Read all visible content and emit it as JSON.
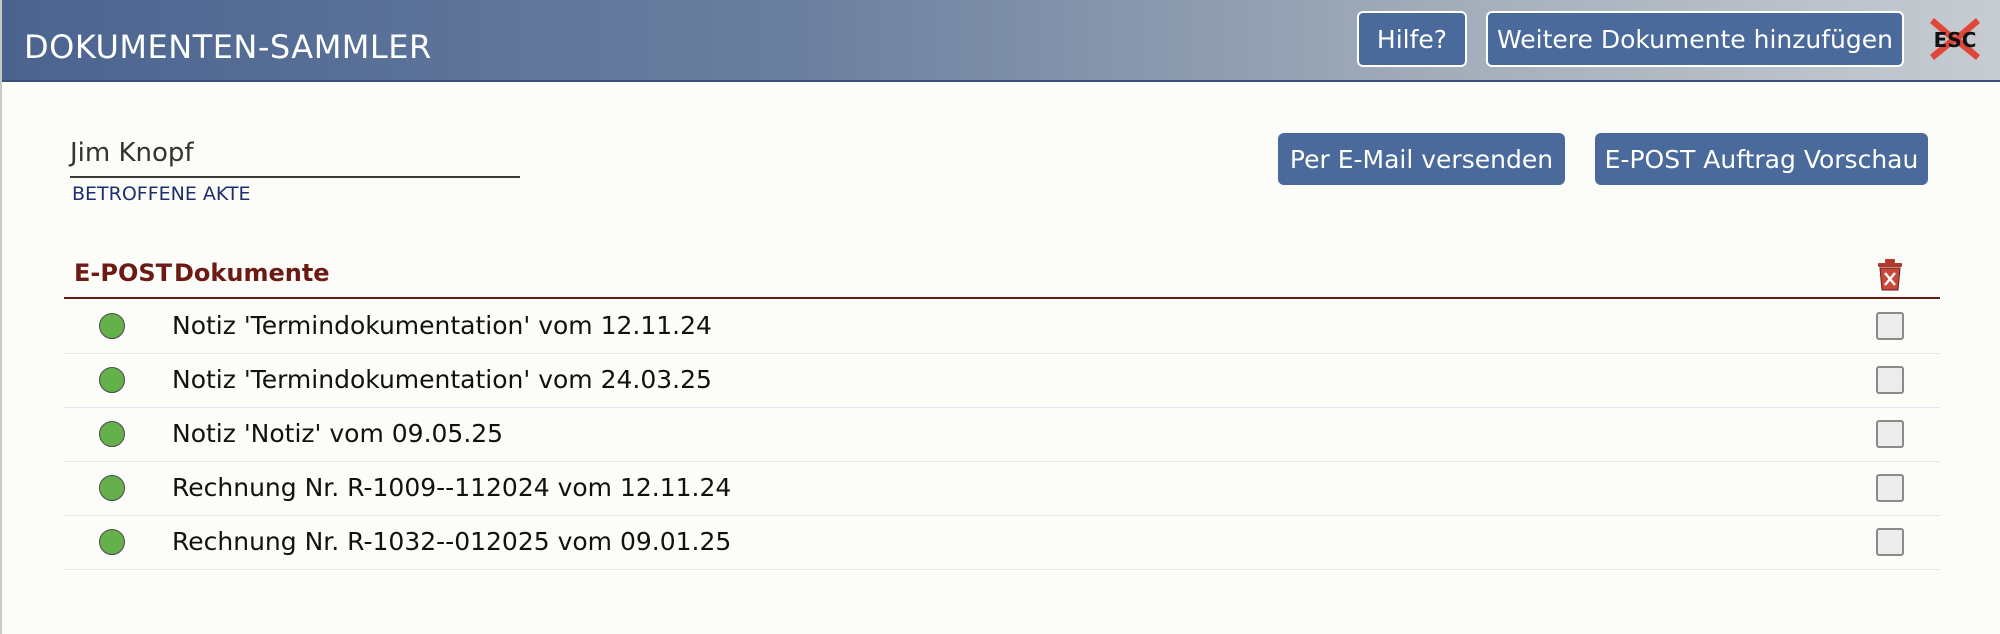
{
  "header": {
    "title": "DOKUMENTEN-SAMMLER",
    "help_label": "Hilfe?",
    "add_label": "Weitere Dokumente hinzufügen",
    "close_label": "ESC",
    "close_icon": "close-x-icon"
  },
  "record": {
    "name": "Jim Knopf",
    "field_label": "BETROFFENE AKTE"
  },
  "actions": {
    "email_label": "Per E-Mail versenden",
    "preview_label": "E-POST Auftrag Vorschau"
  },
  "table": {
    "col_epost": "E-POST",
    "col_documents": "Dokumente",
    "delete_icon": "trash-icon",
    "accent_color": "#6e1a14",
    "rows": [
      {
        "status": "green",
        "label": "Notiz 'Termindokumentation' vom 12.11.24",
        "checked": false
      },
      {
        "status": "green",
        "label": "Notiz 'Termindokumentation' vom 24.03.25",
        "checked": false
      },
      {
        "status": "green",
        "label": "Notiz 'Notiz' vom 09.05.25",
        "checked": false
      },
      {
        "status": "green",
        "label": "Rechnung Nr. R-1009--112024 vom 12.11.24",
        "checked": false
      },
      {
        "status": "green",
        "label": "Rechnung Nr. R-1032--012025 vom 09.01.25",
        "checked": false
      }
    ]
  },
  "colors": {
    "header_gradient_start": "#4a6490",
    "button_bg": "#4a6a9b",
    "status_green": "#64b14c"
  }
}
